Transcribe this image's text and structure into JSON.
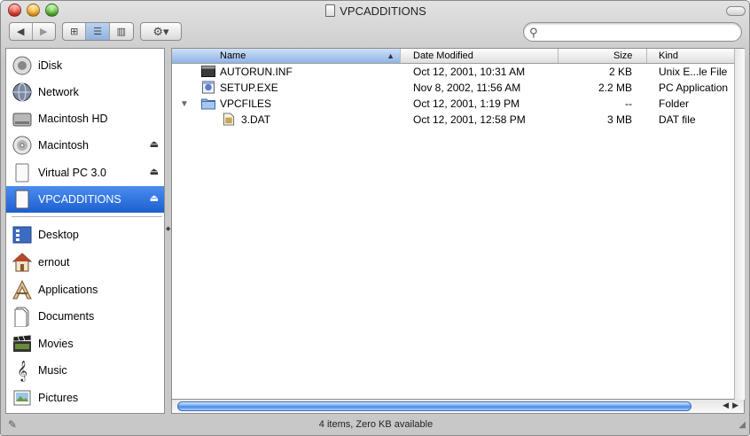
{
  "window": {
    "title": "VPCADDITIONS"
  },
  "toolbar": {
    "back_glyph": "◀",
    "forward_glyph": "▶",
    "icon_view_glyph": "⊞",
    "list_view_glyph": "☰",
    "column_view_glyph": "▥",
    "action_glyph": "⚙▾",
    "search_glyph": "⚲",
    "search_value": "",
    "search_placeholder": ""
  },
  "sidebar": {
    "items": [
      {
        "label": "iDisk",
        "icon": "idisk-icon",
        "eject": false
      },
      {
        "label": "Network",
        "icon": "network-globe-icon",
        "eject": false
      },
      {
        "label": "Macintosh HD",
        "icon": "hard-drive-icon",
        "eject": false
      },
      {
        "label": "Macintosh",
        "icon": "cd-disc-icon",
        "eject": true
      },
      {
        "label": "Virtual PC 3.0",
        "icon": "drive-icon",
        "eject": true
      },
      {
        "label": "VPCADDITIONS",
        "icon": "drive-icon",
        "eject": true,
        "selected": true
      },
      {
        "label": "Desktop",
        "icon": "desktop-icon",
        "eject": false
      },
      {
        "label": "ernout",
        "icon": "home-icon",
        "eject": false
      },
      {
        "label": "Applications",
        "icon": "applications-icon",
        "eject": false
      },
      {
        "label": "Documents",
        "icon": "documents-icon",
        "eject": false
      },
      {
        "label": "Movies",
        "icon": "movies-clapper-icon",
        "eject": false
      },
      {
        "label": "Music",
        "icon": "music-clef-icon",
        "eject": false
      },
      {
        "label": "Pictures",
        "icon": "pictures-icon",
        "eject": false
      }
    ],
    "eject_glyph": "⏏"
  },
  "list": {
    "columns": {
      "name": "Name",
      "date": "Date Modified",
      "size": "Size",
      "kind": "Kind"
    },
    "sort_arrow": "▲",
    "rows": [
      {
        "name": "AUTORUN.INF",
        "date": "Oct 12, 2001, 10:31 AM",
        "size": "2 KB",
        "kind": "Unix E...le File",
        "icon": "unix-exec-icon"
      },
      {
        "name": "SETUP.EXE",
        "date": "Nov 8, 2002, 11:56 AM",
        "size": "2.2 MB",
        "kind": "PC Application",
        "icon": "pc-app-icon"
      },
      {
        "name": "VPCFILES",
        "date": "Oct 12, 2001, 1:19 PM",
        "size": "--",
        "kind": "Folder",
        "icon": "folder-icon",
        "expanded": true
      },
      {
        "name": "3.DAT",
        "date": "Oct 12, 2001, 12:58 PM",
        "size": "3 MB",
        "kind": "DAT file",
        "icon": "dat-file-icon"
      }
    ],
    "disclosure_glyph": "▼"
  },
  "status": {
    "text": "4 items, Zero KB available"
  }
}
